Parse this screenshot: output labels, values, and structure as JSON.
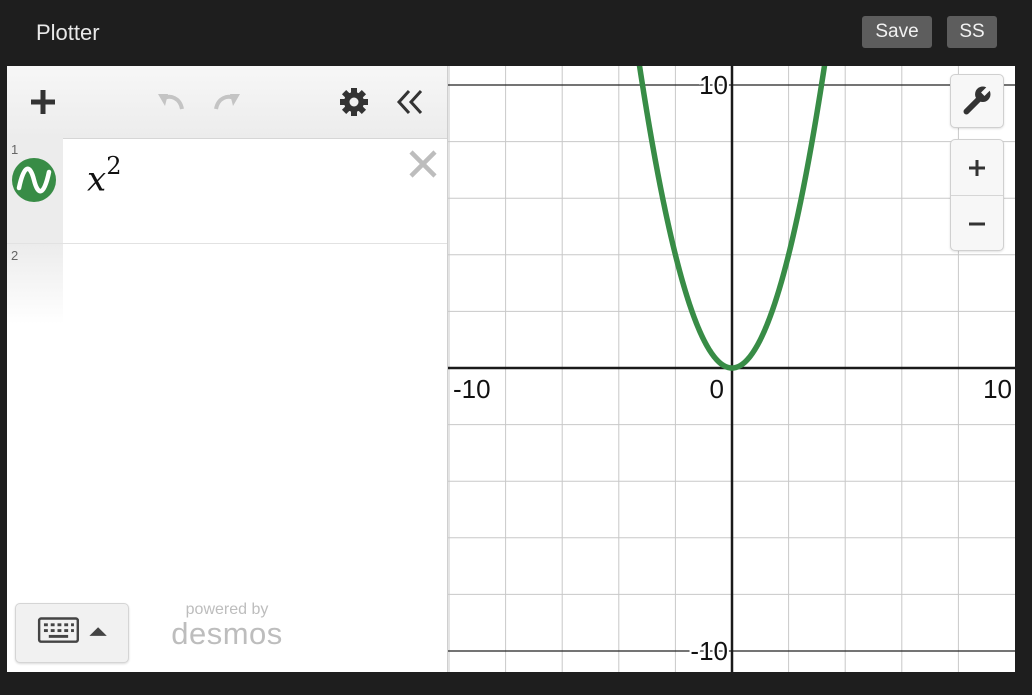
{
  "app": {
    "title": "Plotter"
  },
  "topbar": {
    "save_label": "Save",
    "ss_label": "SS"
  },
  "expressions": [
    {
      "index": "1",
      "latex_base": "x",
      "latex_exp": "2",
      "color": "#388c46"
    },
    {
      "index": "2",
      "latex_base": "",
      "latex_exp": ""
    }
  ],
  "icons": {
    "add": "plus-icon",
    "undo": "undo-icon",
    "redo": "redo-icon",
    "settings": "gear-icon",
    "collapse": "double-chevron-left-icon",
    "delete": "close-icon",
    "keyboard": "keyboard-icon",
    "wrench": "wrench-icon",
    "zoom_in": "plus-icon",
    "zoom_out": "minus-icon"
  },
  "branding": {
    "line1": "powered by",
    "line2": "desmos"
  },
  "chart_data": {
    "type": "line",
    "series": [
      {
        "function": "x^2",
        "color": "#388c46"
      }
    ],
    "xlim": [
      -10,
      10
    ],
    "ylim": [
      -10.7,
      10.7
    ],
    "grid": true,
    "grid_step": 2,
    "tick_labels": {
      "x": [
        {
          "value": -10,
          "label": "-10"
        },
        {
          "value": 0,
          "label": "0"
        },
        {
          "value": 10,
          "label": "10"
        }
      ],
      "y": [
        {
          "value": 10,
          "label": "10"
        },
        {
          "value": -10,
          "label": "-10"
        }
      ]
    }
  }
}
